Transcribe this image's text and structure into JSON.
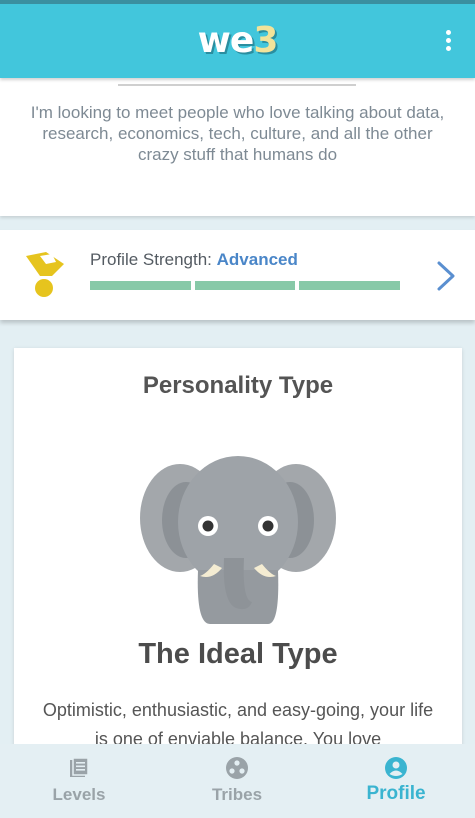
{
  "header": {
    "logo_main": "we",
    "logo_accent": "3",
    "menu_icon": "more-vert-icon"
  },
  "bio": {
    "text": "I'm looking to meet people who love talking about data, research, economics, tech, culture, and all the other crazy stuff that humans do"
  },
  "profile_strength": {
    "label": "Profile Strength:",
    "value": "Advanced",
    "filled_segments": 3,
    "total_segments": 3,
    "icon": "medal-icon"
  },
  "personality": {
    "heading": "Personality Type",
    "type_name": "The Ideal Type",
    "description": "Optimistic, enthusiastic, and easy-going, your life is one of enviable balance. You love",
    "illustration": "elephant-illustration"
  },
  "nav": {
    "items": [
      {
        "label": "Levels",
        "icon": "levels-icon"
      },
      {
        "label": "Tribes",
        "icon": "tribes-icon"
      },
      {
        "label": "Profile",
        "icon": "profile-icon"
      }
    ],
    "active_index": 2
  },
  "colors": {
    "header": "#42c6dc",
    "accent_blue": "#4a86c8",
    "bar_green": "#87c9a8",
    "active_nav": "#3ab4d0"
  }
}
